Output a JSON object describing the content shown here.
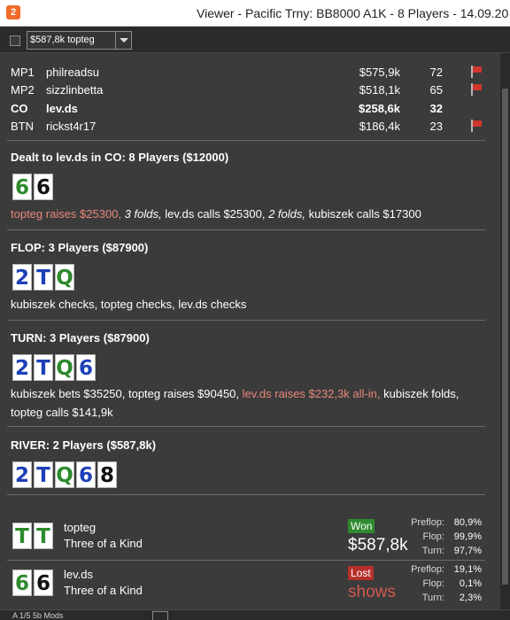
{
  "window": {
    "app_icon_text": "2",
    "title": "Viewer - Pacific Trny: BB8000 A1K - 8 Players - 14.09.20"
  },
  "toolbar": {
    "filter_value": "$587,8k topteg"
  },
  "players": [
    {
      "pos": "MP1",
      "name": "philreadsu",
      "stack": "$575,9k",
      "num": "72",
      "flag": true,
      "bold": false
    },
    {
      "pos": "MP2",
      "name": "sizzlinbetta",
      "stack": "$518,1k",
      "num": "65",
      "flag": true,
      "bold": false
    },
    {
      "pos": "CO",
      "name": "lev.ds",
      "stack": "$258,6k",
      "num": "32",
      "flag": false,
      "bold": true
    },
    {
      "pos": "BTN",
      "name": "rickst4r17",
      "stack": "$186,4k",
      "num": "23",
      "flag": true,
      "bold": false
    }
  ],
  "preflop": {
    "title": "Dealt to lev.ds in CO: 8 Players ($12000)",
    "cards": [
      "6",
      "6"
    ],
    "actions": {
      "a1": "topteg raises $25300,",
      "a2": "3 folds,",
      "a3": "lev.ds calls $25300,",
      "a4": "2 folds,",
      "a5": "kubiszek calls $17300"
    }
  },
  "flop": {
    "title": "FLOP: 3 Players ($87900)",
    "cards": [
      "2",
      "T",
      "Q"
    ],
    "actions": "kubiszek checks, topteg checks, lev.ds checks"
  },
  "turn": {
    "title": "TURN: 3 Players ($87900)",
    "cards": [
      "2",
      "T",
      "Q",
      "6"
    ],
    "actions": {
      "a1": "kubiszek bets $35250, topteg raises $90450,",
      "a2": "lev.ds raises $232,3k all-in,",
      "a3": "kubiszek folds, topteg calls $141,9k"
    }
  },
  "river": {
    "title": "RIVER: 2 Players ($587,8k)",
    "cards": [
      "2",
      "T",
      "Q",
      "6",
      "8"
    ]
  },
  "results": [
    {
      "cards": [
        "T",
        "T"
      ],
      "name": "topteg",
      "hand": "Three of a Kind",
      "badge": "Won",
      "amount": "$587,8k",
      "stats": {
        "preflop_label": "Preflop:",
        "preflop": "80,9%",
        "flop_label": "Flop:",
        "flop": "99,9%",
        "turn_label": "Turn:",
        "turn": "97,7%"
      }
    },
    {
      "cards": [
        "6",
        "6"
      ],
      "name": "lev.ds",
      "hand": "Three of a Kind",
      "badge": "Lost",
      "amount": "shows",
      "stats": {
        "preflop_label": "Preflop:",
        "preflop": "19,1%",
        "flop_label": "Flop:",
        "flop": "0,1%",
        "turn_label": "Turn:",
        "turn": "2,3%"
      }
    }
  ],
  "statusbar": {
    "text": "A 1/5 5b Mods"
  },
  "colors": {
    "highlight_action": "#e8877b",
    "won_badge": "#2f8a2f",
    "lost_badge": "#b8302a",
    "flag": "#d0362b"
  }
}
